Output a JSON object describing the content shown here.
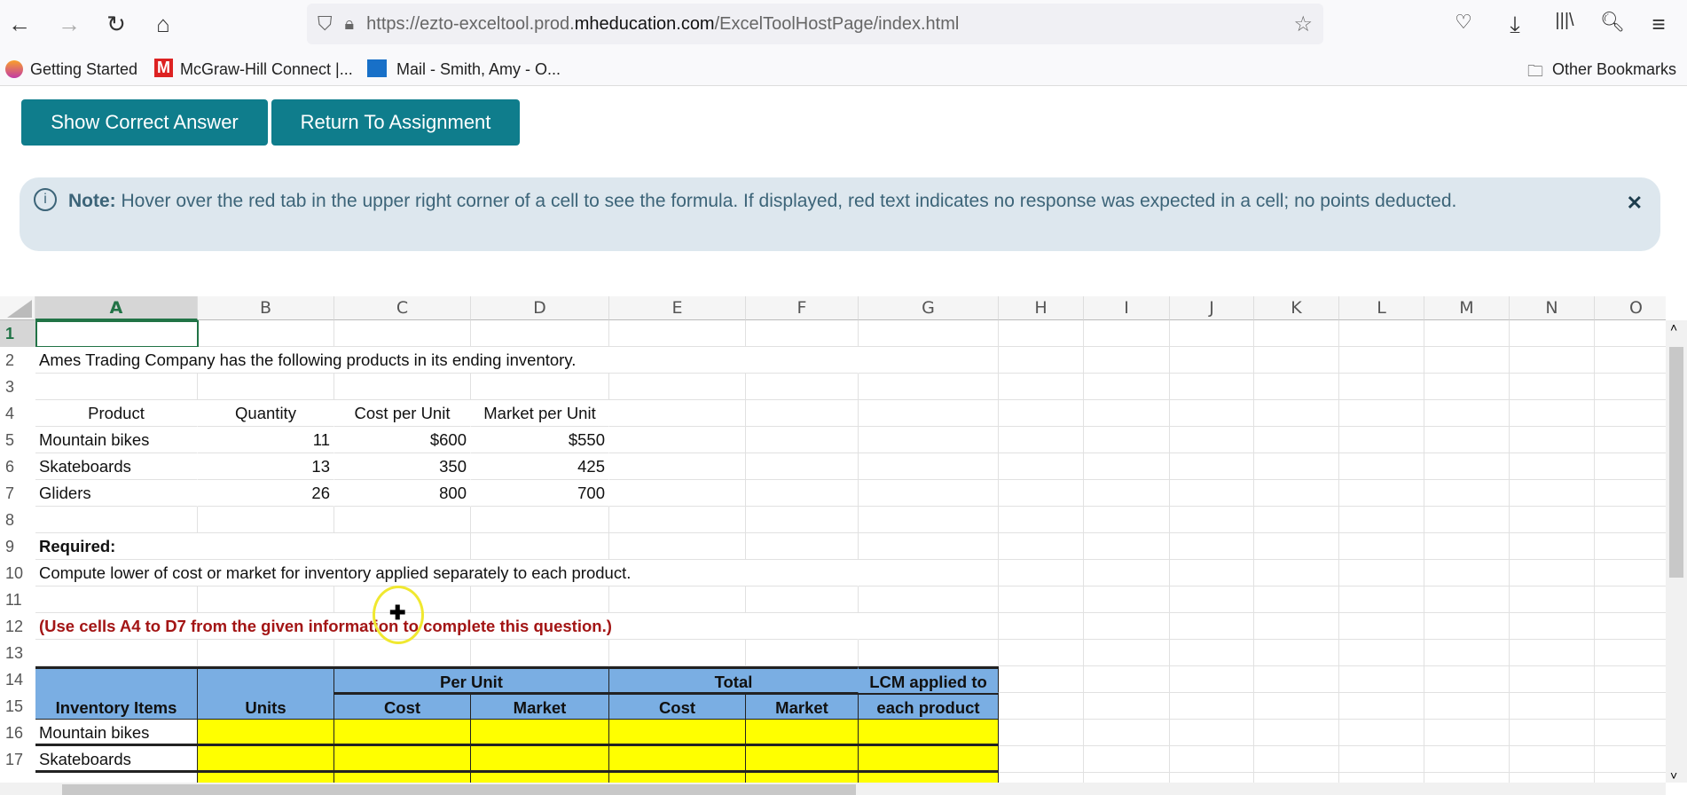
{
  "browser": {
    "url_prefix": "https://ezto-exceltool.prod.",
    "url_host": "mheducation.com",
    "url_path": "/ExcelToolHostPage/index.html",
    "bookmarks": [
      "Getting Started",
      "McGraw-Hill Connect |...",
      "Mail - Smith, Amy - O..."
    ],
    "other_bookmarks": "Other Bookmarks"
  },
  "buttons": {
    "show_answer": "Show Correct Answer",
    "return": "Return To Assignment"
  },
  "note": {
    "label": "Note:",
    "text": " Hover over the red tab in the upper right corner of a cell to see the formula. If displayed, red text indicates no response was expected in a cell; no points deducted.",
    "close": "✕"
  },
  "columns": [
    "A",
    "B",
    "C",
    "D",
    "E",
    "F",
    "G",
    "H",
    "I",
    "J",
    "K",
    "L",
    "M",
    "N",
    "O"
  ],
  "rows": [
    "1",
    "2",
    "3",
    "4",
    "5",
    "6",
    "7",
    "8",
    "9",
    "10",
    "11",
    "12",
    "13",
    "14",
    "15",
    "16",
    "17"
  ],
  "sheet": {
    "intro": "Ames Trading Company has the following products in its ending inventory.",
    "headers": [
      "Product",
      "Quantity",
      "Cost per Unit",
      "Market per Unit"
    ],
    "products": [
      [
        "Mountain bikes",
        "11",
        "$600",
        "$550"
      ],
      [
        "Skateboards",
        "13",
        "350",
        "425"
      ],
      [
        "Gliders",
        "26",
        "800",
        "700"
      ]
    ],
    "required": "Required:",
    "task": "Compute lower of cost or market for inventory applied separately to each product.",
    "hint": "(Use cells A4 to D7 from the given information to complete this question.)",
    "table": {
      "items": "Inventory Items",
      "units": "Units",
      "per_unit": "Per Unit",
      "total": "Total",
      "cost": "Cost",
      "market": "Market",
      "lcm1": "LCM applied to",
      "lcm2": "each product",
      "rows": [
        "Mountain bikes",
        "Skateboards"
      ]
    }
  }
}
